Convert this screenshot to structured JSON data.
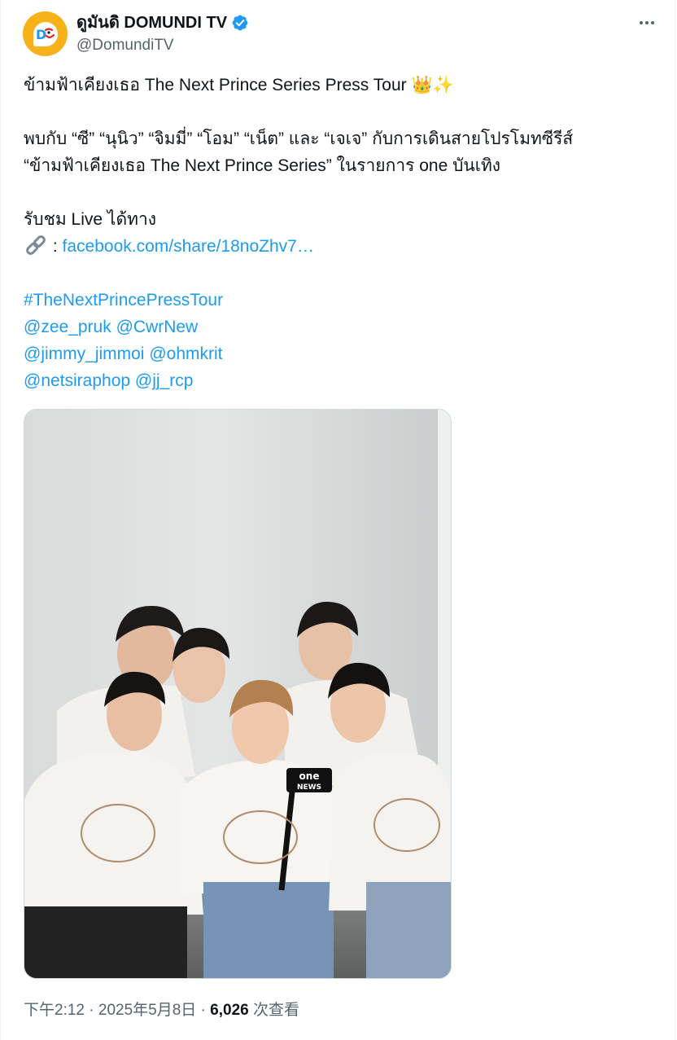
{
  "author": {
    "display_name": "ดูมันดิ DOMUNDI TV",
    "handle": "@DomundiTV",
    "avatar_icon": "domundi-logo-icon",
    "avatar_color": "#f7b21a",
    "verified_icon": "verified-badge-icon"
  },
  "more_icon": "more-options-icon",
  "tweet": {
    "line1": "ข้ามฟ้าเคียงเธอ The Next Prince Series Press Tour",
    "line1_emojis": "👑✨",
    "line2": "พบกับ “ซี” “นุนิว” “จิมมี่” “โอม” “เน็ต” และ “เจเจ” กับการเดินสายโปรโมทซีรีส์",
    "line3": "“ข้ามฟ้าเคียงเธอ The Next Prince Series” ในรายการ one บันเทิง",
    "line4": "รับชม Live ได้ทาง",
    "link_icon": "link-icon",
    "link_prefix": " : ",
    "link_text": "facebook.com/share/18noZhv7…",
    "hashtag": "#TheNextPrincePressTour",
    "mentions_1a": "@zee_pruk",
    "mentions_1b": "@CwrNew",
    "mentions_2a": "@jimmy_jimmoi",
    "mentions_2b": "@ohmkrit",
    "mentions_3a": "@netsiraphop",
    "mentions_3b": "@jj_rcp"
  },
  "media": {
    "mic_label_top": "one",
    "mic_label_bottom": "NEWS",
    "shirt_print": "I LOVE EMMALLY"
  },
  "meta": {
    "time": "下午2:12",
    "separator": " · ",
    "date": "2025年5月8日",
    "views_count": "6,026",
    "views_label": " 次查看"
  },
  "colors": {
    "link": "#1d9bf0",
    "secondary_text": "#536471",
    "primary_text": "#0f1419",
    "verified": "#1d9bf0"
  }
}
